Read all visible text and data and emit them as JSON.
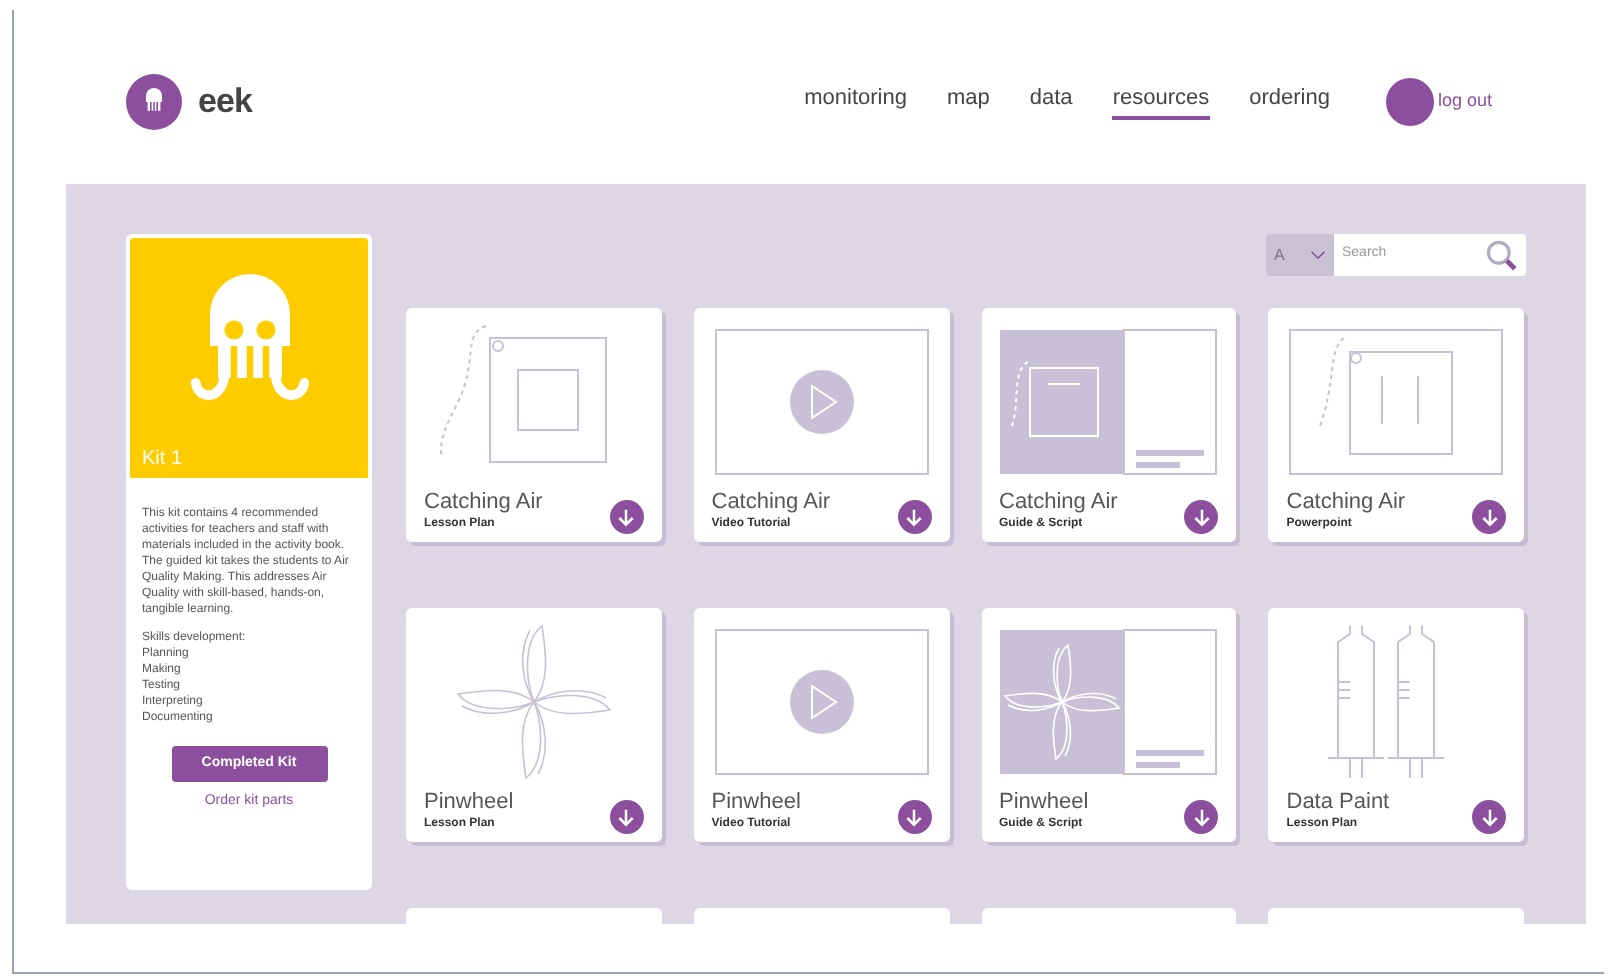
{
  "brand": "eek",
  "nav": [
    {
      "label": "monitoring",
      "selected": false
    },
    {
      "label": "map",
      "selected": false
    },
    {
      "label": "data",
      "selected": false
    },
    {
      "label": "resources",
      "selected": true
    },
    {
      "label": "ordering",
      "selected": false
    }
  ],
  "logout": "log out",
  "filter": {
    "value": "A"
  },
  "search": {
    "placeholder": "Search"
  },
  "kit": {
    "title": "Kit 1",
    "description": "This kit contains 4 recommended activities for teachers and staff with materials included in the activity book. The guided kit takes the students to Air Quality Making. This addresses Air Quality with skill-based, hands-on, tangible learning.",
    "skills_heading": "Skills development:",
    "skills": [
      "Planning",
      "Making",
      "Testing",
      "Interpreting",
      "Documenting"
    ],
    "button": "Completed Kit",
    "link": "Order kit parts"
  },
  "resources": [
    {
      "kind": "lesson",
      "title": "Catching Air",
      "type": "Lesson Plan"
    },
    {
      "kind": "video",
      "title": "Catching Air",
      "type": "Video Tutorial"
    },
    {
      "kind": "guide",
      "title": "Catching Air",
      "type": "Guide & Script"
    },
    {
      "kind": "slides",
      "title": "Catching Air",
      "type": "Powerpoint"
    },
    {
      "kind": "pinwheel",
      "title": "Pinwheel",
      "type": "Lesson Plan"
    },
    {
      "kind": "video",
      "title": "Pinwheel",
      "type": "Video Tutorial"
    },
    {
      "kind": "pinwheel-guide",
      "title": "Pinwheel",
      "type": "Guide & Script"
    },
    {
      "kind": "syringes",
      "title": "Data Paint",
      "type": "Lesson Plan"
    }
  ]
}
